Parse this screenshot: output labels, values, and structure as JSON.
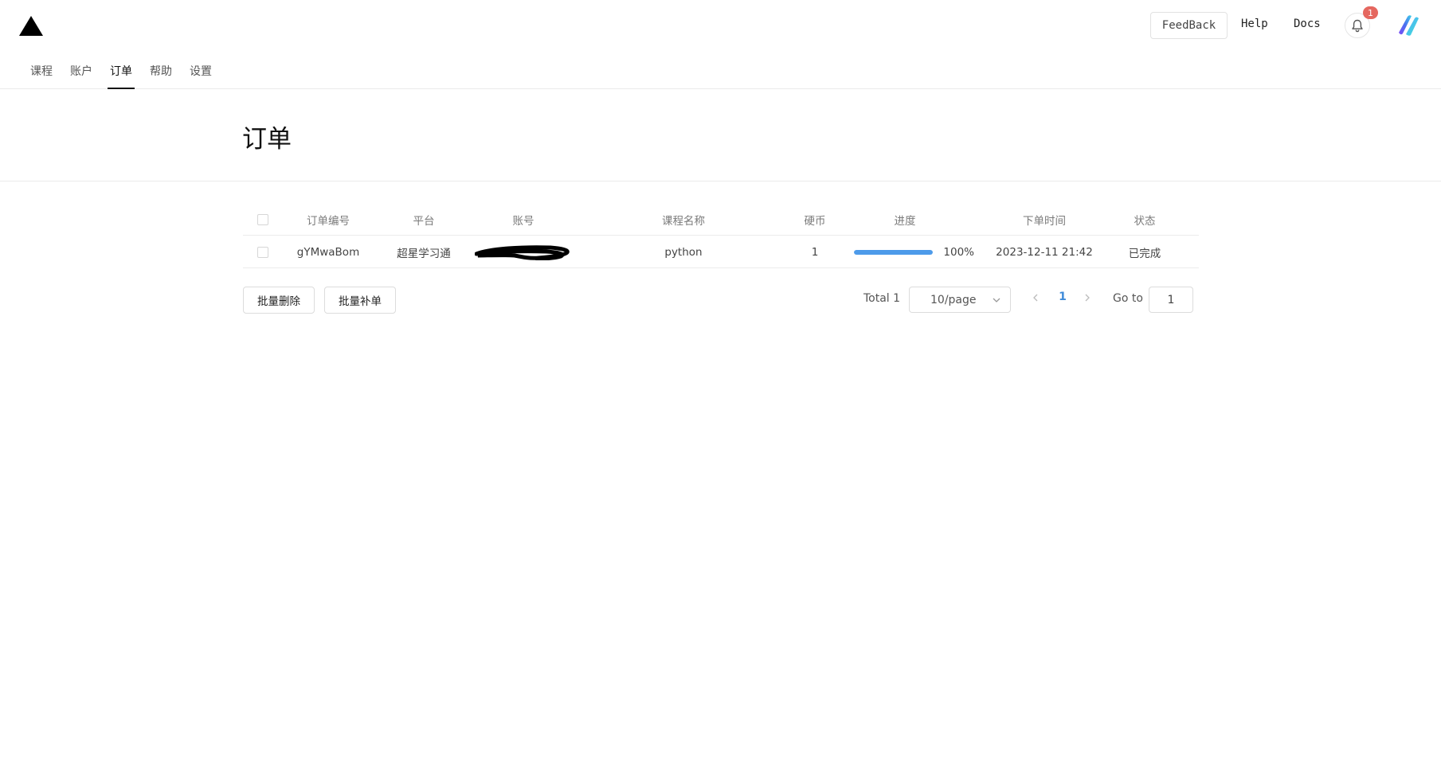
{
  "header": {
    "logo_icon": "triangle-logo-icon",
    "feedback_label": "FeedBack",
    "help_label": "Help",
    "docs_label": "Docs",
    "notification_count": "1",
    "notification_icon": "bell-icon",
    "avatar_icon": "gradient-avatar-icon",
    "badge_color": "#e5675f"
  },
  "nav": {
    "items": [
      {
        "label": "课程",
        "active": false
      },
      {
        "label": "账户",
        "active": false
      },
      {
        "label": "订单",
        "active": true
      },
      {
        "label": "帮助",
        "active": false
      },
      {
        "label": "设置",
        "active": false
      }
    ]
  },
  "page": {
    "title": "订单"
  },
  "table": {
    "columns": [
      "订单编号",
      "平台",
      "账号",
      "课程名称",
      "硬币",
      "进度",
      "下单时间",
      "状态"
    ],
    "rows": [
      {
        "order_id": "gYMwaBom",
        "platform": "超星学习通",
        "account": "",
        "account_redacted": true,
        "course": "python",
        "coins": "1",
        "progress_value": 100,
        "progress_text": "100%",
        "order_time": "2023-12-11 21:42",
        "status": "已完成"
      }
    ],
    "progress_color": "#4d9bea"
  },
  "actions": {
    "batch_delete": "批量删除",
    "batch_supplement": "批量补单"
  },
  "pagination": {
    "total_text": "Total 1",
    "page_size": "10/page",
    "current_page": "1",
    "goto_label": "Go to",
    "goto_value": "1",
    "active_color": "#3f8bd9"
  }
}
